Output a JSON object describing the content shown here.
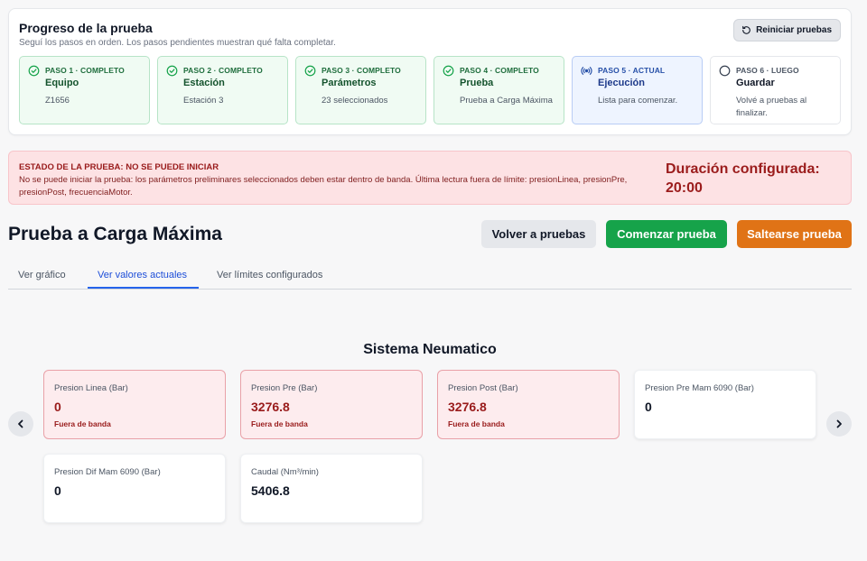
{
  "progress": {
    "title": "Progreso de la prueba",
    "subtitle": "Seguí los pasos en orden. Los pasos pendientes muestran qué falta completar.",
    "reset_label": "Reiniciar pruebas",
    "steps": [
      {
        "label": "PASO 1 · COMPLETO",
        "name": "Equipo",
        "value": "Z1656",
        "status": "complete"
      },
      {
        "label": "PASO 2 · COMPLETO",
        "name": "Estación",
        "value": "Estación 3",
        "status": "complete"
      },
      {
        "label": "PASO 3 · COMPLETO",
        "name": "Parámetros",
        "value": "23 seleccionados",
        "status": "complete"
      },
      {
        "label": "PASO 4 · COMPLETO",
        "name": "Prueba",
        "value": "Prueba a Carga Máxima",
        "status": "complete"
      },
      {
        "label": "PASO 5 · ACTUAL",
        "name": "Ejecución",
        "value": "Lista para comenzar.",
        "status": "current"
      },
      {
        "label": "PASO 6 · LUEGO",
        "name": "Guardar",
        "value": "Volvé a pruebas al finalizar.",
        "status": "pending"
      }
    ]
  },
  "alert": {
    "title": "ESTADO DE LA PRUEBA: NO SE PUEDE INICIAR",
    "message": "No se puede iniciar la prueba: los parámetros preliminares seleccionados deben estar dentro de banda. Última lectura fuera de límite: presionLinea, presionPre, presionPost, frecuenciaMotor.",
    "duration_label": "Duración configurada:",
    "duration_value": "20:00"
  },
  "page": {
    "title": "Prueba a Carga Máxima",
    "back_label": "Volver a pruebas",
    "start_label": "Comenzar prueba",
    "skip_label": "Saltearse prueba"
  },
  "tabs": [
    {
      "label": "Ver gráfico"
    },
    {
      "label": "Ver valores actuales"
    },
    {
      "label": "Ver límites configurados"
    }
  ],
  "section": {
    "title": "Sistema Neumatico",
    "metrics": [
      {
        "label": "Presion Linea (Bar)",
        "value": "0",
        "status": "Fuera de banda"
      },
      {
        "label": "Presion Pre (Bar)",
        "value": "3276.8",
        "status": "Fuera de banda"
      },
      {
        "label": "Presion Post (Bar)",
        "value": "3276.8",
        "status": "Fuera de banda"
      },
      {
        "label": "Presion Pre Mam 6090 (Bar)",
        "value": "0",
        "status": ""
      },
      {
        "label": "Presion Dif Mam 6090 (Bar)",
        "value": "0",
        "status": ""
      },
      {
        "label": "Caudal (Nm³/min)",
        "value": "5406.8",
        "status": ""
      }
    ]
  },
  "colors": {
    "complete": "#16a34a",
    "current": "#2750a8",
    "alert": "#9b1c1c",
    "accent": "#2563eb",
    "skip": "#e07316"
  }
}
